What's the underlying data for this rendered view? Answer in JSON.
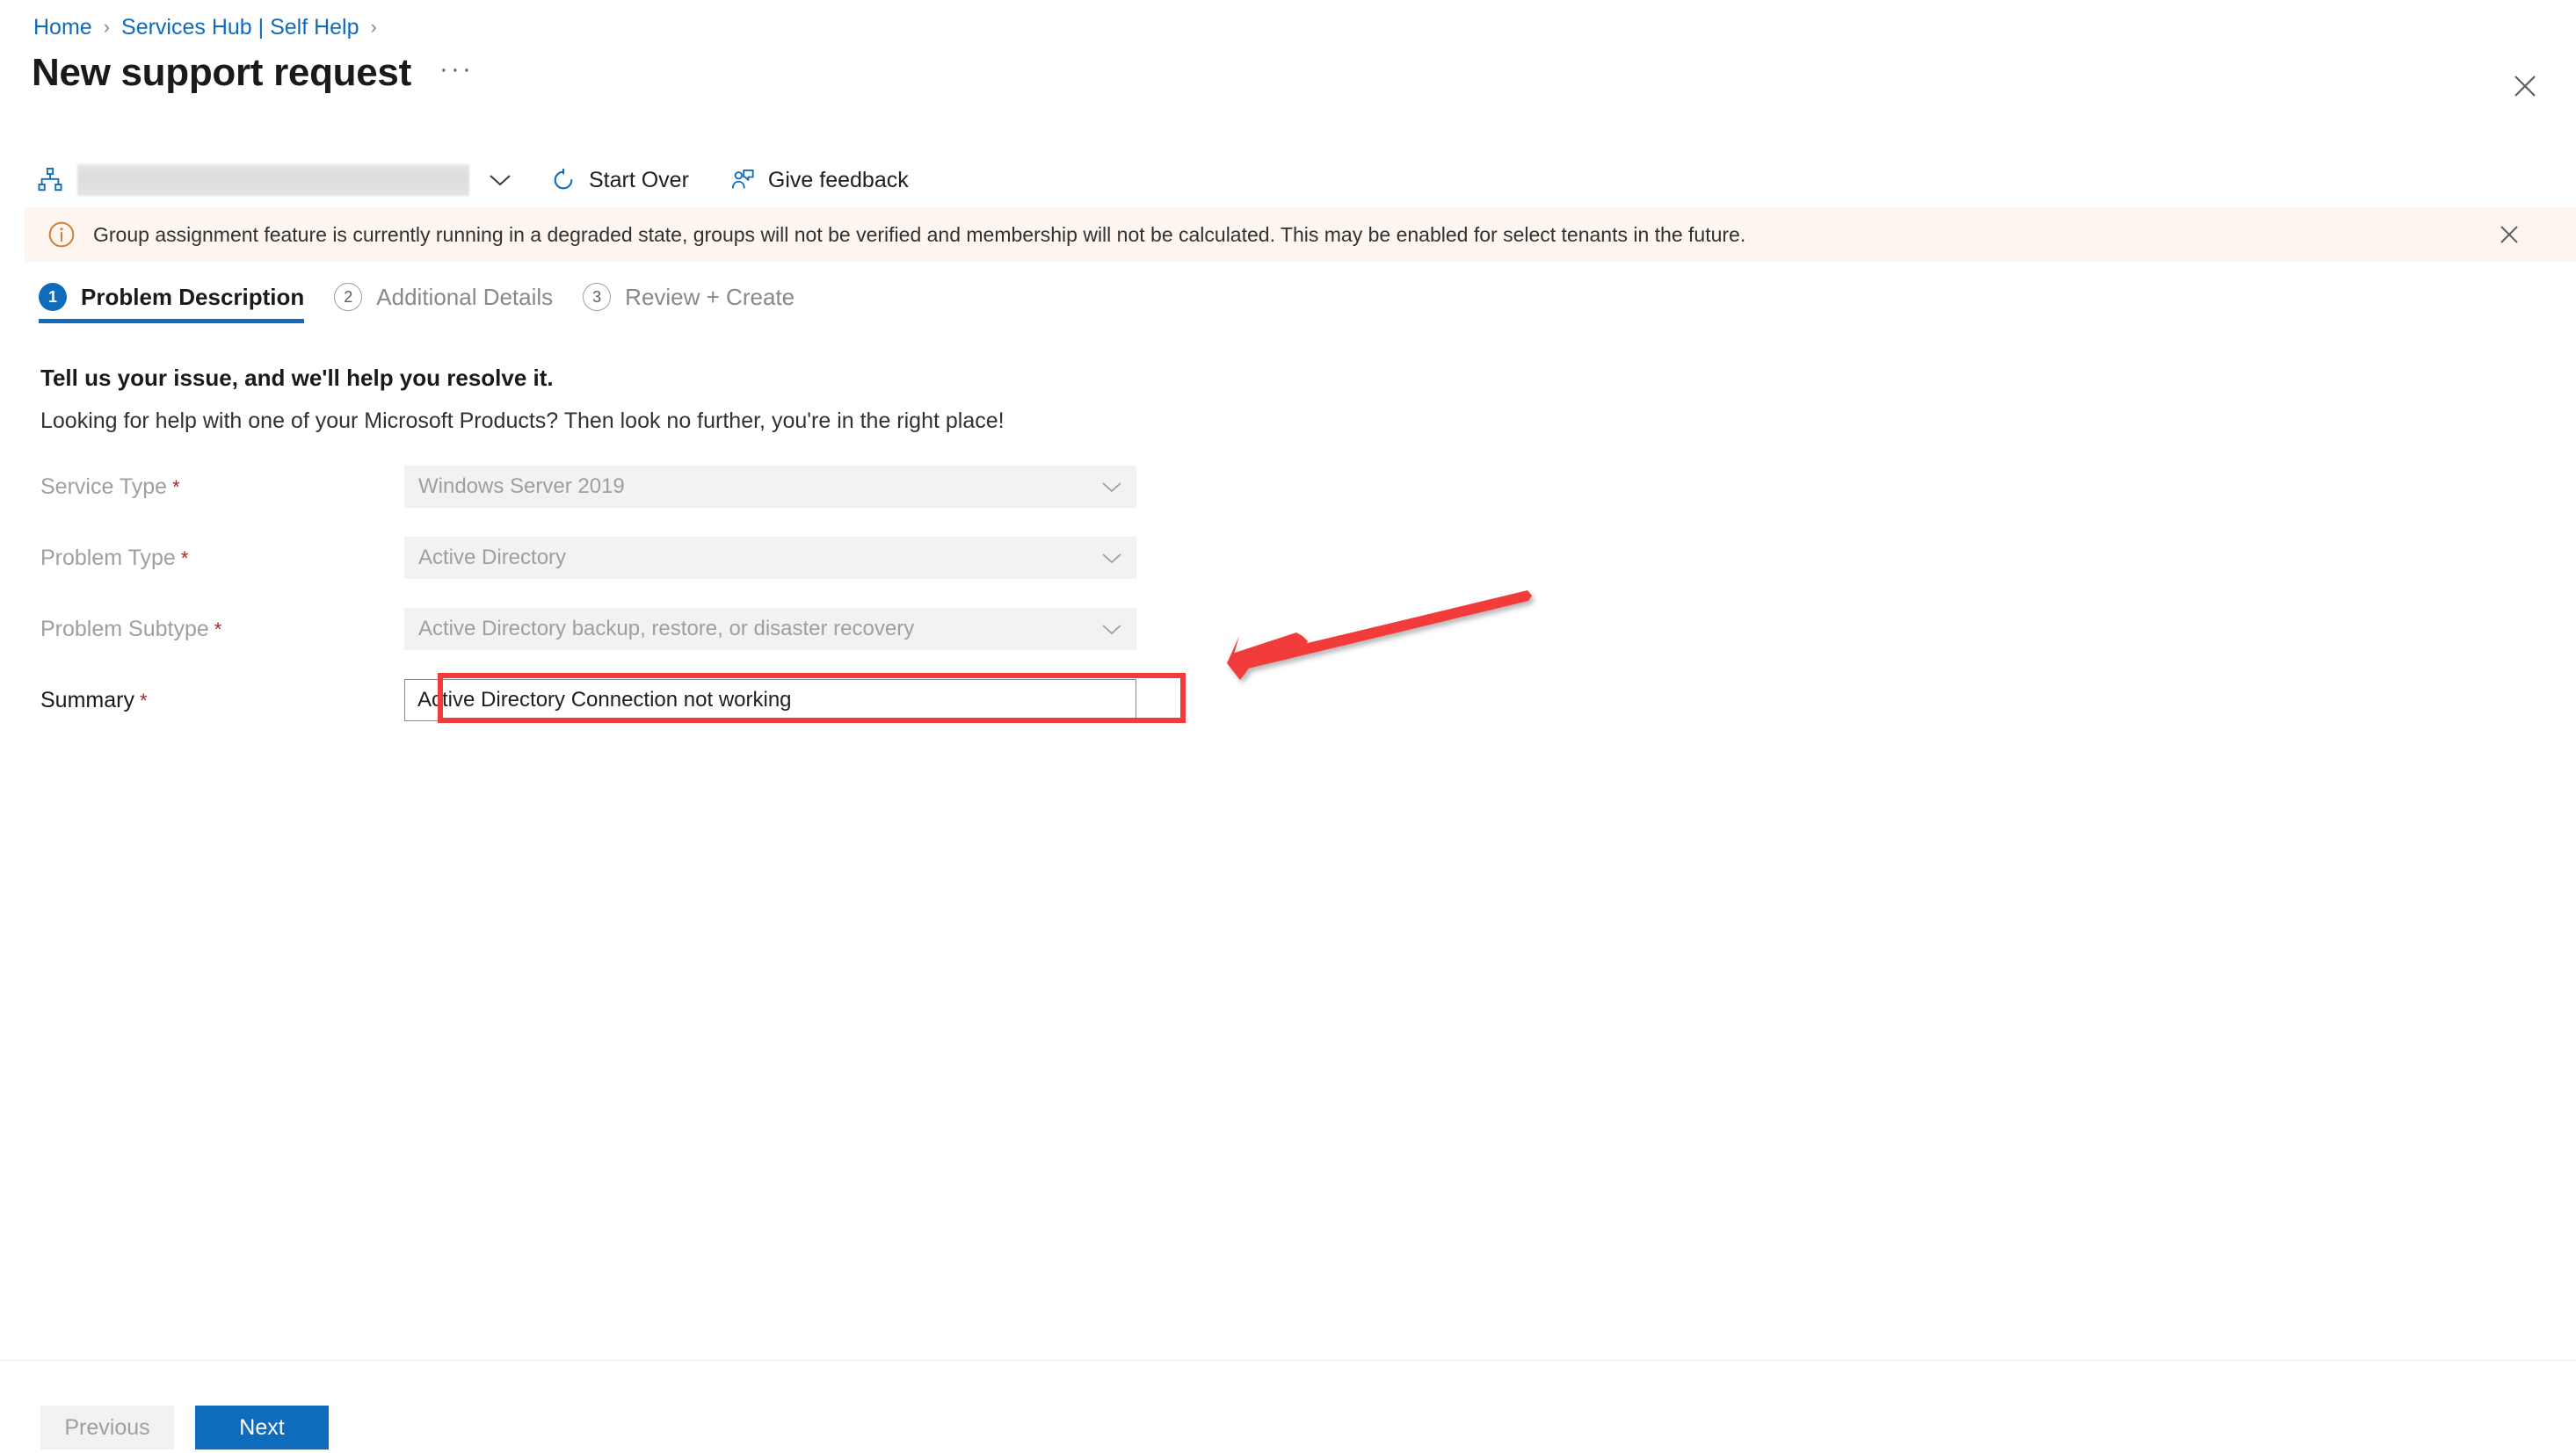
{
  "breadcrumb": {
    "items": [
      {
        "label": "Home"
      },
      {
        "label": "Services Hub | Self Help"
      }
    ],
    "separator": "›"
  },
  "header": {
    "title": "New support request",
    "ellipsis": "···",
    "close_icon": "close-icon"
  },
  "commandbar": {
    "tenant": {
      "icon": "hierarchy-icon",
      "value": "",
      "redacted": true,
      "chevron_icon": "chevron-down-icon"
    },
    "buttons": [
      {
        "label": "Start Over",
        "icon": "refresh-icon"
      },
      {
        "label": "Give feedback",
        "icon": "feedback-person-icon"
      }
    ]
  },
  "banner": {
    "icon": "info-icon",
    "text": "Group assignment feature is currently running in a degraded state, groups will not be verified and membership will not be calculated. This may be enabled for select tenants in the future.",
    "close_icon": "close-icon",
    "background": "#fdf6f0",
    "icon_color": "#d08030"
  },
  "tabs": [
    {
      "number": "1",
      "label": "Problem Description",
      "state": "active"
    },
    {
      "number": "2",
      "label": "Additional Details",
      "state": "inactive"
    },
    {
      "number": "3",
      "label": "Review + Create",
      "state": "inactive"
    }
  ],
  "intro": {
    "heading": "Tell us your issue, and we'll help you resolve it.",
    "subheading": "Looking for help with one of your Microsoft Products? Then look no further, you're in the right place!"
  },
  "form": {
    "required_marker": "*",
    "fields": [
      {
        "label": "Service Type",
        "value": "Windows Server 2019",
        "control": "select",
        "disabled": true
      },
      {
        "label": "Problem Type",
        "value": "Active Directory",
        "control": "select",
        "disabled": true
      },
      {
        "label": "Problem Subtype",
        "value": "Active Directory backup, restore, or disaster recovery",
        "control": "select",
        "disabled": true
      },
      {
        "label": "Summary",
        "value": "Active Directory Connection not working",
        "control": "text",
        "disabled": false,
        "highlighted": true
      }
    ]
  },
  "annotations": {
    "rectangle_color": "#f23b3b",
    "arrow_color": "#f23b3b",
    "target": "summary-field"
  },
  "footer": {
    "previous_label": "Previous",
    "next_label": "Next",
    "next_color": "#0f6cbd"
  }
}
